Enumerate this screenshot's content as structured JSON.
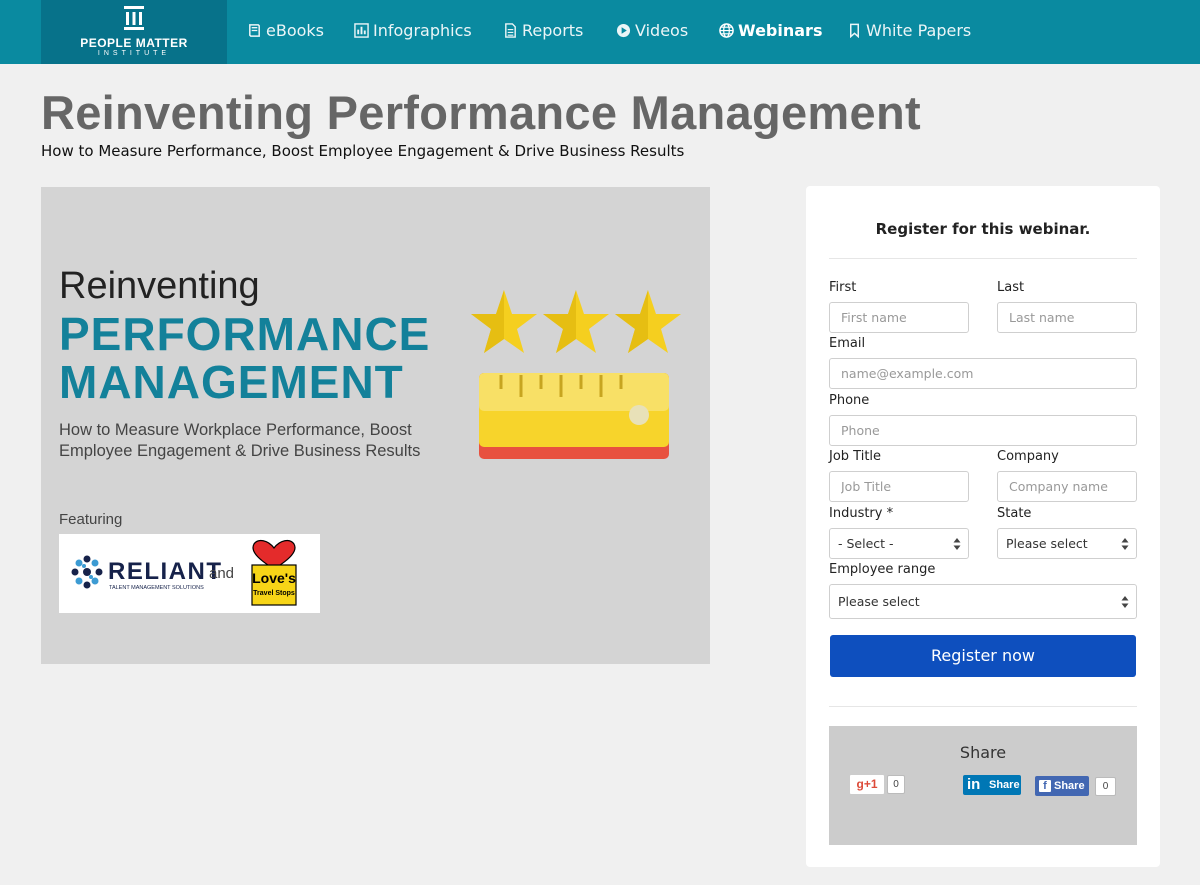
{
  "brand": {
    "name_line1": "PEOPLE MATTER",
    "name_line2": "INSTITUTE"
  },
  "nav": {
    "items": [
      {
        "label": "eBooks",
        "icon": "book-icon"
      },
      {
        "label": "Infographics",
        "icon": "bar-chart-icon"
      },
      {
        "label": "Reports",
        "icon": "document-icon"
      },
      {
        "label": "Videos",
        "icon": "play-circle-icon"
      },
      {
        "label": "Webinars",
        "icon": "globe-icon",
        "active": true
      },
      {
        "label": "White Papers",
        "icon": "bookmark-icon"
      }
    ]
  },
  "page": {
    "title": "Reinventing Performance Management",
    "subtitle": "How to Measure Performance, Boost Employee Engagement & Drive Business Results"
  },
  "hero": {
    "line1": "Reinventing",
    "line2": "PERFORMANCE",
    "line3": "MANAGEMENT",
    "description": "How to Measure Workplace Performance, Boost Employee Engagement & Drive Business Results",
    "featuring": "Featuring",
    "sponsor1": "RELIANT",
    "sponsor1_tagline": "TALENT MANAGEMENT SOLUTIONS",
    "and": "and",
    "sponsor2": "Love's",
    "sponsor2_tagline": "Travel Stops",
    "colors": {
      "accent": "#13819a",
      "star": "#f5cf1f",
      "ruler": "#f6dc3a",
      "ruler_base": "#e8513f"
    }
  },
  "form": {
    "title": "Register for this webinar.",
    "first": {
      "label": "First",
      "placeholder": "First name"
    },
    "last": {
      "label": "Last",
      "placeholder": "Last name"
    },
    "email": {
      "label": "Email",
      "placeholder": "name@example.com"
    },
    "phone": {
      "label": "Phone",
      "placeholder": "Phone"
    },
    "job_title": {
      "label": "Job Title",
      "placeholder": "Job Title"
    },
    "company": {
      "label": "Company",
      "placeholder": "Company name"
    },
    "industry": {
      "label": "Industry *",
      "value": "- Select -"
    },
    "state": {
      "label": "State",
      "value": "Please select"
    },
    "employee_range": {
      "label": "Employee range",
      "value": "Please select"
    },
    "submit": "Register now",
    "colors": {
      "button": "#0e4fbe"
    }
  },
  "share": {
    "title": "Share",
    "gplus": {
      "label": "g+1",
      "count": "0"
    },
    "linkedin": {
      "label": "Share"
    },
    "facebook": {
      "label": "Share",
      "count": "0"
    }
  }
}
